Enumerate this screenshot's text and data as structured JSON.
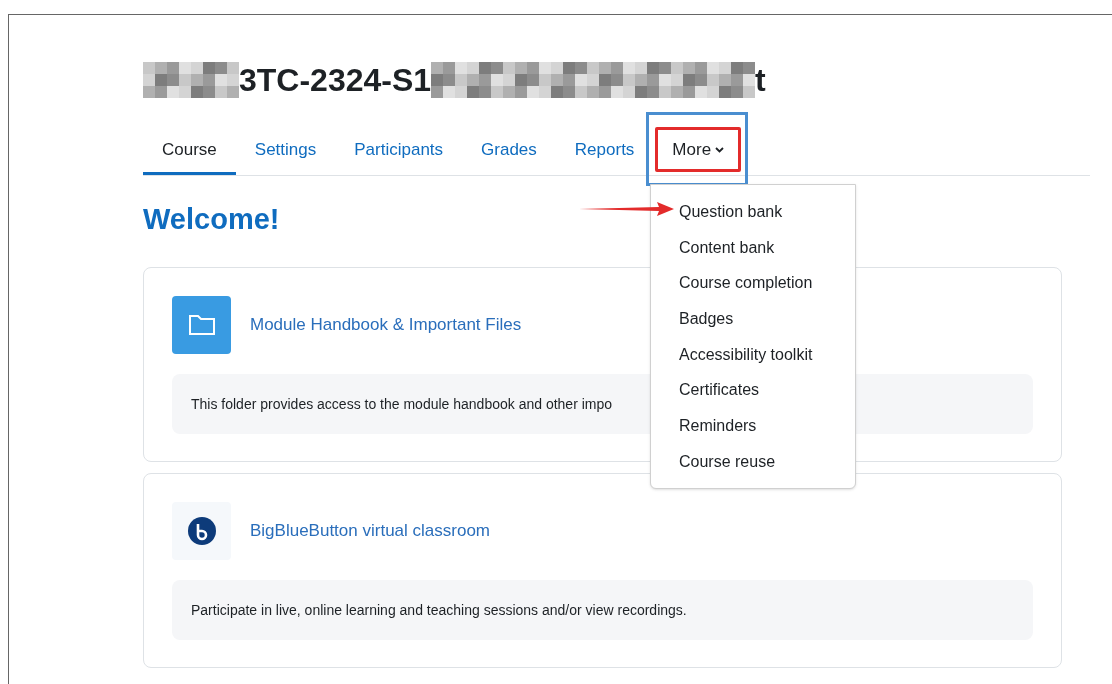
{
  "title_parts": [
    "3TC-2324-S1",
    "t"
  ],
  "tabs": [
    {
      "label": "Course",
      "selected": true,
      "expanded": false,
      "kind": "link"
    },
    {
      "label": "Settings",
      "selected": false,
      "expanded": false,
      "kind": "link"
    },
    {
      "label": "Participants",
      "selected": false,
      "expanded": false,
      "kind": "link"
    },
    {
      "label": "Grades",
      "selected": false,
      "expanded": false,
      "kind": "link"
    },
    {
      "label": "Reports",
      "selected": false,
      "expanded": false,
      "kind": "link"
    },
    {
      "label": "More",
      "selected": false,
      "expanded": true,
      "kind": "dropdown"
    }
  ],
  "more_menu": [
    "Question bank",
    "Content bank",
    "Course completion",
    "Badges",
    "Accessibility toolkit",
    "Certificates",
    "Reminders",
    "Course reuse"
  ],
  "heading": "Welcome!",
  "activities": [
    {
      "kind": "folder",
      "title": "Module Handbook & Important Files",
      "description": "This folder provides access to the module handbook and other impo"
    },
    {
      "kind": "bigbluebutton",
      "title": "BigBlueButton virtual classroom",
      "description": "Participate in live, online learning and teaching sessions and/or view recordings."
    }
  ]
}
